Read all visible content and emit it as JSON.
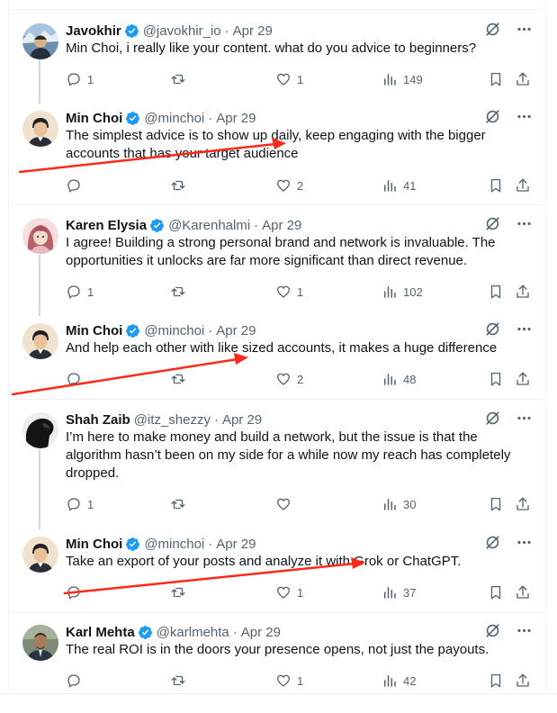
{
  "colors": {
    "verified": "#1d9bf0",
    "text": "#0f1419",
    "secondary": "#536471",
    "annotation_arrow": "#ff2a1a",
    "thread_line": "#cfd9de"
  },
  "tweets": [
    {
      "name": "Javokhir",
      "handle": "@javokhir_io",
      "sep": "·",
      "date": "Apr 29",
      "text": "Min Choi, i really like your content. what do you advice to beginners?",
      "replies": "1",
      "retweets": "",
      "likes": "1",
      "views": "149"
    },
    {
      "name": "Min Choi",
      "handle": "@minchoi",
      "sep": "·",
      "date": "Apr 29",
      "text": "The simplest advice is to show up daily, keep engaging with the bigger accounts that has your target audience",
      "replies": "",
      "retweets": "",
      "likes": "2",
      "views": "41"
    },
    {
      "name": "Karen Elysia",
      "handle": "@Karenhalmi",
      "sep": "·",
      "date": "Apr 29",
      "text": "I agree! Building a strong personal brand and network is invaluable. The opportunities it unlocks are far more significant than direct revenue.",
      "replies": "1",
      "retweets": "",
      "likes": "1",
      "views": "102"
    },
    {
      "name": "Min Choi",
      "handle": "@minchoi",
      "sep": "·",
      "date": "Apr 29",
      "text": "And help each other with like sized accounts, it makes a huge difference",
      "replies": "",
      "retweets": "",
      "likes": "2",
      "views": "48"
    },
    {
      "name": "Shah Zaib",
      "handle": "@itz_shezzy",
      "sep": "·",
      "date": "Apr 29",
      "text": "I’m here to make money and build a network, but the issue is that the algorithm hasn’t been on my side for a while now my reach has completely dropped.",
      "replies": "1",
      "retweets": "",
      "likes": "",
      "views": "30"
    },
    {
      "name": "Min Choi",
      "handle": "@minchoi",
      "sep": "·",
      "date": "Apr 29",
      "text": "Take an export of your posts and analyze it with Grok or ChatGPT.",
      "replies": "",
      "retweets": "",
      "likes": "1",
      "views": "37"
    },
    {
      "name": "Karl Mehta",
      "handle": "@karlmehta",
      "sep": "·",
      "date": "Apr 29",
      "text": "The real ROI is in the doors your presence opens, not just the payouts.",
      "replies": "",
      "retweets": "",
      "likes": "1",
      "views": "42"
    }
  ]
}
